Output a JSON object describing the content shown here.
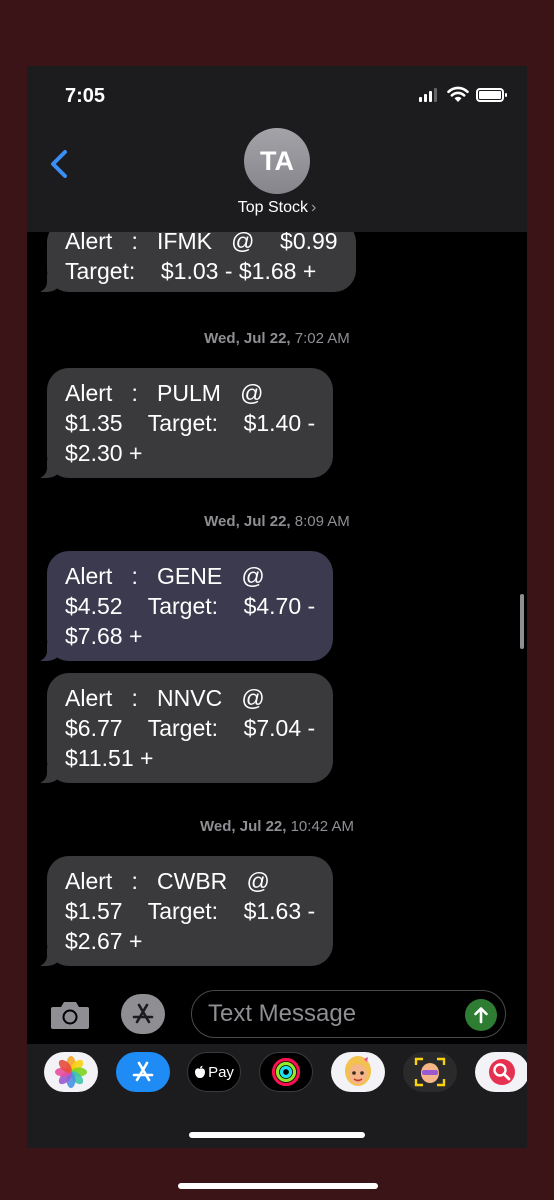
{
  "status": {
    "time": "7:05"
  },
  "header": {
    "avatar_initials": "TA",
    "contact_name": "Top Stock",
    "chevron": "›"
  },
  "messages": [
    {
      "text": "Alert   :   IFMK   @    $0.99\nTarget:    $1.03 - $1.68 +"
    },
    {
      "timestamp_day": "Wed, Jul 22,",
      "timestamp_time": "7:02 AM"
    },
    {
      "text": "Alert   :   PULM   @\n$1.35    Target:    $1.40 -\n$2.30 +"
    },
    {
      "timestamp_day": "Wed, Jul 22,",
      "timestamp_time": "8:09 AM"
    },
    {
      "text": "Alert   :   GENE   @\n$4.52    Target:    $4.70 -\n$7.68 +"
    },
    {
      "text": "Alert   :   NNVC   @\n$6.77    Target:    $7.04 -\n$11.51 +"
    },
    {
      "timestamp_day": "Wed, Jul 22,",
      "timestamp_time": "10:42 AM"
    },
    {
      "text": "Alert   :   CWBR   @\n$1.57    Target:    $1.63 -\n$2.67 +"
    }
  ],
  "input": {
    "placeholder": "Text Message"
  },
  "apps": [
    {
      "icon": "photos-icon"
    },
    {
      "icon": "app-store-icon"
    },
    {
      "icon": "apple-pay-icon",
      "label": "Pay"
    },
    {
      "icon": "activity-icon"
    },
    {
      "icon": "memoji-icon"
    },
    {
      "icon": "memoji-stickers-icon"
    },
    {
      "icon": "image-search-icon"
    }
  ],
  "colors": {
    "bubble": "#3a3a3c",
    "bubble_highlight": "#3b3a4e",
    "send": "#2f7d32",
    "back_chevron": "#3a8ef6",
    "frame": "#3b1418"
  }
}
